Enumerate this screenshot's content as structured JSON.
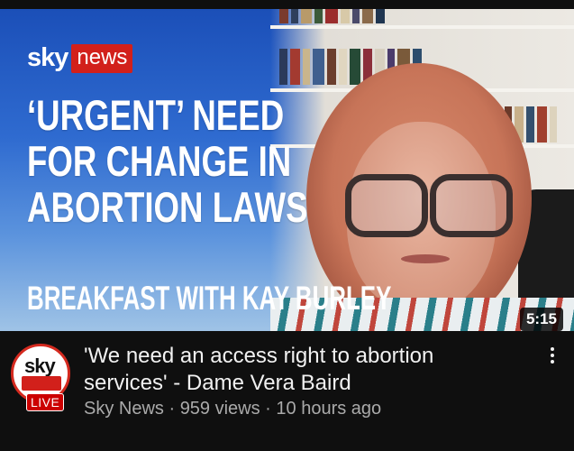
{
  "thumbnail": {
    "brand_sky": "sky",
    "brand_news": "news",
    "headline_lines": [
      "‘URGENT’ NEED",
      "FOR CHANGE IN",
      "ABORTION LAWS"
    ],
    "show_name": "BREAKFAST WITH KAY BURLEY",
    "duration": "5:15"
  },
  "video": {
    "title": "'We need an access right to abortion services' - Dame Vera Baird",
    "channel": "Sky News",
    "views": "959 views",
    "age": "10 hours ago",
    "separator": " · "
  },
  "channel_avatar": {
    "logo_text": "sky",
    "badge": "LIVE",
    "icon": "sky-news-logo-icon"
  },
  "menu": {
    "icon": "more-vert-icon"
  },
  "colors": {
    "background": "#0f0f0f",
    "brand_red": "#d2201b",
    "live_red": "#cc0000",
    "title_text": "#f1f1f1",
    "meta_text": "#aaaaaa"
  }
}
